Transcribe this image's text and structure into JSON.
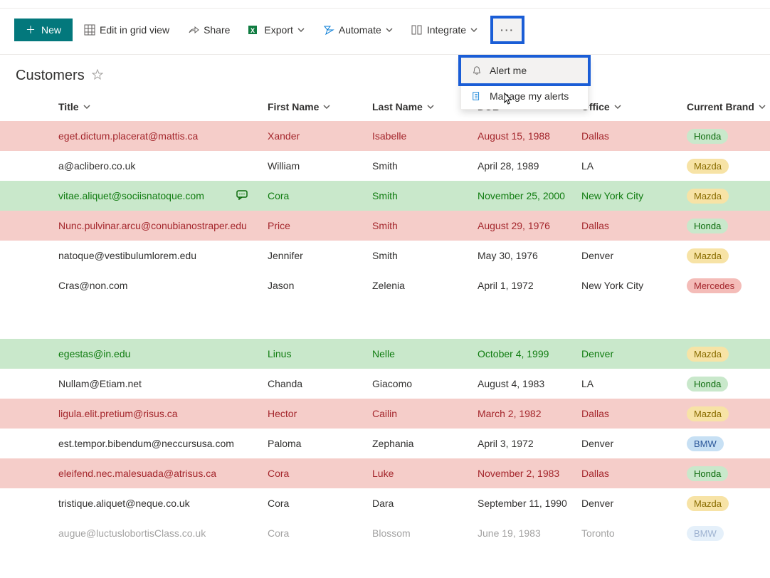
{
  "toolbar": {
    "new_label": "New",
    "edit_grid_label": "Edit in grid view",
    "share_label": "Share",
    "export_label": "Export",
    "automate_label": "Automate",
    "integrate_label": "Integrate"
  },
  "overflow_menu": {
    "alert_me": "Alert me",
    "manage_alerts": "Manage my alerts"
  },
  "page": {
    "title": "Customers"
  },
  "columns": {
    "title": "Title",
    "first_name": "First Name",
    "last_name": "Last Name",
    "dob": "DOB",
    "office": "Office",
    "brand": "Current Brand"
  },
  "rows": [
    {
      "title": "eget.dictum.placerat@mattis.ca",
      "first": "Xander",
      "last": "Isabelle",
      "dob": "August 15, 1988",
      "office": "Dallas",
      "brand": "Honda",
      "state": "pink",
      "comment": false
    },
    {
      "title": "a@aclibero.co.uk",
      "first": "William",
      "last": "Smith",
      "dob": "April 28, 1989",
      "office": "LA",
      "brand": "Mazda",
      "state": "",
      "comment": false
    },
    {
      "title": "vitae.aliquet@sociisnatoque.com",
      "first": "Cora",
      "last": "Smith",
      "dob": "November 25, 2000",
      "office": "New York City",
      "brand": "Mazda",
      "state": "green",
      "comment": true
    },
    {
      "title": "Nunc.pulvinar.arcu@conubianostraper.edu",
      "first": "Price",
      "last": "Smith",
      "dob": "August 29, 1976",
      "office": "Dallas",
      "brand": "Honda",
      "state": "pink",
      "comment": false
    },
    {
      "title": "natoque@vestibulumlorem.edu",
      "first": "Jennifer",
      "last": "Smith",
      "dob": "May 30, 1976",
      "office": "Denver",
      "brand": "Mazda",
      "state": "",
      "comment": false
    },
    {
      "title": "Cras@non.com",
      "first": "Jason",
      "last": "Zelenia",
      "dob": "April 1, 1972",
      "office": "New York City",
      "brand": "Mercedes",
      "state": "",
      "comment": false
    }
  ],
  "rows2": [
    {
      "title": "egestas@in.edu",
      "first": "Linus",
      "last": "Nelle",
      "dob": "October 4, 1999",
      "office": "Denver",
      "brand": "Mazda",
      "state": "green",
      "comment": false
    },
    {
      "title": "Nullam@Etiam.net",
      "first": "Chanda",
      "last": "Giacomo",
      "dob": "August 4, 1983",
      "office": "LA",
      "brand": "Honda",
      "state": "",
      "comment": false
    },
    {
      "title": "ligula.elit.pretium@risus.ca",
      "first": "Hector",
      "last": "Cailin",
      "dob": "March 2, 1982",
      "office": "Dallas",
      "brand": "Mazda",
      "state": "pink",
      "comment": false
    },
    {
      "title": "est.tempor.bibendum@neccursusa.com",
      "first": "Paloma",
      "last": "Zephania",
      "dob": "April 3, 1972",
      "office": "Denver",
      "brand": "BMW",
      "state": "",
      "comment": false
    },
    {
      "title": "eleifend.nec.malesuada@atrisus.ca",
      "first": "Cora",
      "last": "Luke",
      "dob": "November 2, 1983",
      "office": "Dallas",
      "brand": "Honda",
      "state": "pink",
      "comment": false
    },
    {
      "title": "tristique.aliquet@neque.co.uk",
      "first": "Cora",
      "last": "Dara",
      "dob": "September 11, 1990",
      "office": "Denver",
      "brand": "Mazda",
      "state": "",
      "comment": false
    },
    {
      "title": "augue@luctuslobortisClass.co.uk",
      "first": "Cora",
      "last": "Blossom",
      "dob": "June 19, 1983",
      "office": "Toronto",
      "brand": "BMW",
      "state": "",
      "comment": false,
      "fade": true
    }
  ]
}
